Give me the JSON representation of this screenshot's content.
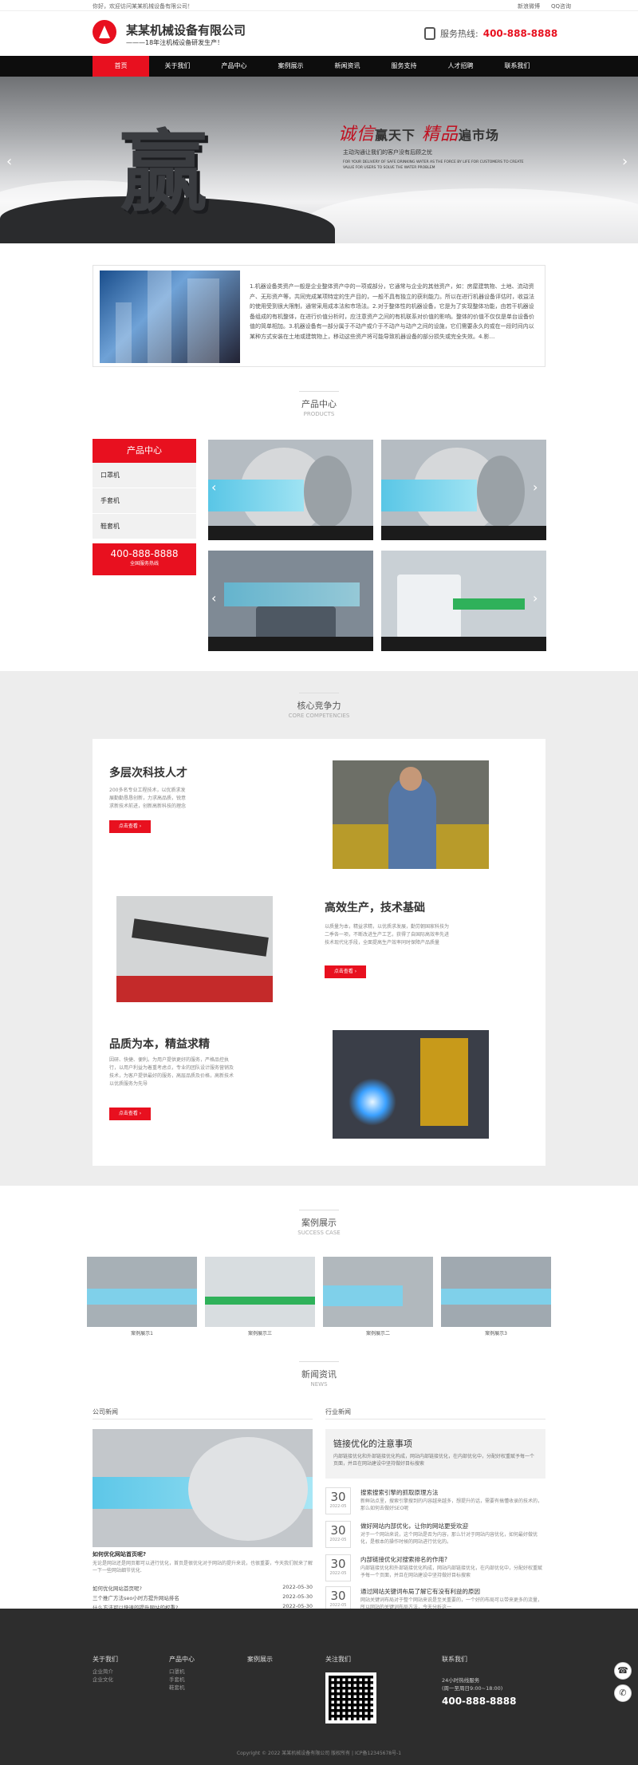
{
  "topbar": {
    "welcome": "你好，欢迎访问某某机械设备有限公司！",
    "weibo": "新浪微博",
    "qq": "QQ咨询"
  },
  "header": {
    "company": "某某机械设备有限公司",
    "slogan": "———18年注机械设备研发生产！",
    "hotline_label": "服务热线:",
    "hotline": "400-888-8888"
  },
  "nav": [
    "首页",
    "关于我们",
    "产品中心",
    "案例展示",
    "新闻资讯",
    "服务支持",
    "人才招聘",
    "联系我们"
  ],
  "banner": {
    "char": "赢",
    "title_a": "诚信",
    "title_b": "赢天下",
    "title_c": "精品",
    "title_d": "遍市场",
    "sub": "主动沟通让我们的客户没有后顾之忧",
    "en": "FOR YOUR DELIVERY OF SAFE DRINKING WATER AS THE FORCE BY LIFE FOR CUSTOMERS TO CREATE VALUE FOR USERS TO SOLVE THE WATER PROBLEM"
  },
  "about": {
    "text": "1.机器设备类资产一般是企业整体资产中的一项或部分，它通常与企业的其他资产，如：房屋建筑物、土地、流动资产、无形资产等，共同完成某项特定的生产目的，一般不具有独立的获利能力。所以在进行机器设备评估时，收益法的使用受到很大限制，通常采用成本法和市场法。2.对于整体性的机器设备，它是为了实现整体功能，由若干机器设备组成的有机整体，在进行价值分析时，应注意资产之间的有机联系对价值的影响。整体的价值不仅仅是单台设备价值的简单相加。3.机器设备有一部分属于不动产或介于不动产与动产之间的设施，它们需要永久的或在一段时间内以某种方式安装在土地或建筑物上，移动这些资产将可能导致机器设备的部分损失或完全失效。4.影..."
  },
  "products": {
    "title": "产品中心",
    "en": "PRODUCTS",
    "side_title": "产品中心",
    "categories": [
      "口罩机",
      "手套机",
      "鞋套机"
    ],
    "tel": "400-888-8888",
    "tel_sub": "全国服务热线"
  },
  "core": {
    "title": "核心竞争力",
    "en": "CORE COMPETENCIES",
    "items": [
      {
        "title": "多层次科技人才",
        "desc": "200多名专业工程技术，以优质求发展勤勤恳恳创新，力求高品质，锐意求新技术前进，创新高新科技的理念",
        "btn": "点击查看 ›"
      },
      {
        "title": "高效生产，技术基础",
        "desc": "以质量为本，精益求精，以优质求发展，勤劳朝国家科技为二季各一项，不断改进生产工艺，获得了自国际高效率先进技术现代化手段，全面提高生产效率同时保障产品质量",
        "btn": "点击查看 ›"
      },
      {
        "title": "品质为本，精益求精",
        "desc": "因研、快捷、便利。为用户提供更好的服务，严格品控执行，以用户利益为着重考虑点，专业的团队设计服务营销及技术，为客户提供最好的服务，高层品质及价格，高新技术以优质服务为先导",
        "btn": "点击查看 ›"
      }
    ]
  },
  "cases": {
    "title": "案例展示",
    "en": "SUCCESS CASE",
    "items": [
      "案例展示1",
      "案例展示三",
      "案例展示二",
      "案例展示3"
    ]
  },
  "news": {
    "title": "新闻资讯",
    "en": "NEWS",
    "company_title": "公司新闻",
    "industry_title": "行业新闻",
    "featured_title": "如何优化网站首页呢?",
    "featured_desc": "无论是网站还是网页都可以进行优化，首页是很优化对于网站的提升来说，也很重要，今天我们就来了解一下一些网站细节优化.",
    "list": [
      {
        "title": "如何优化网站首页呢?",
        "date": "2022-05-30"
      },
      {
        "title": "三个推广方法seo小时方提升网站排名",
        "date": "2022-05-30"
      },
      {
        "title": "什么方法可以快速的提升网站的权重?",
        "date": "2022-05-30"
      }
    ],
    "hot_title": "链接优化的注意事项",
    "hot_desc": "内部链接优化和外部链接优化构成，网站内部链接优化，在内部优化中，分配好权重赋予每一个页面，并且在网站建设中坚持做好目标搜索",
    "items": [
      {
        "day": "30",
        "ym": "2022-05",
        "title": "搜索搜索引擎的抓取原理方法",
        "desc": "新鲜站点里，搜索引擎搜到的内容越来越多，想提升的话，需要有搞懂收录的技术的，那么如何去做好SEO呢"
      },
      {
        "day": "30",
        "ym": "2022-05",
        "title": "做好网站内部优化，让你的网站更受欢迎",
        "desc": "对于一个网站来说，这个网站是否为内容，那么针对于网站内容优化，如何最好做优化，是根本的操作时候的网站进行优化的。"
      },
      {
        "day": "30",
        "ym": "2022-05",
        "title": "内部链接优化对搜索排名的作用?",
        "desc": "内部链接优化和外部链接优化构成，网站内部链接优化，在内部优化中，分配好权重赋予每一个页面，并且在网站建设中坚持做好目标搜索"
      },
      {
        "day": "30",
        "ym": "2022-05",
        "title": "通过网站关键词布局了解它有没有利益的原因",
        "desc": "网站关键词布局对于整个网站来说是至关重要的，一个好的布局可以带来更多的流量，所以网站的关键词布局方法，今天分析这一"
      }
    ]
  },
  "footer": {
    "cols": [
      {
        "title": "关于我们",
        "links": [
          "企业简介",
          "企业文化"
        ]
      },
      {
        "title": "产品中心",
        "links": [
          "口罩机",
          "手套机",
          "鞋套机"
        ]
      },
      {
        "title": "案例展示",
        "links": []
      }
    ],
    "follow": "关注我们",
    "contact": "联系我们",
    "service": "24小时热线服务",
    "hours": "(周一至周日9:00~18:00)",
    "tel": "400-888-8888",
    "copyright": "Copyright © 2022 某某机械设备有限公司 版权所有  |  ICP备12345678号-1"
  }
}
